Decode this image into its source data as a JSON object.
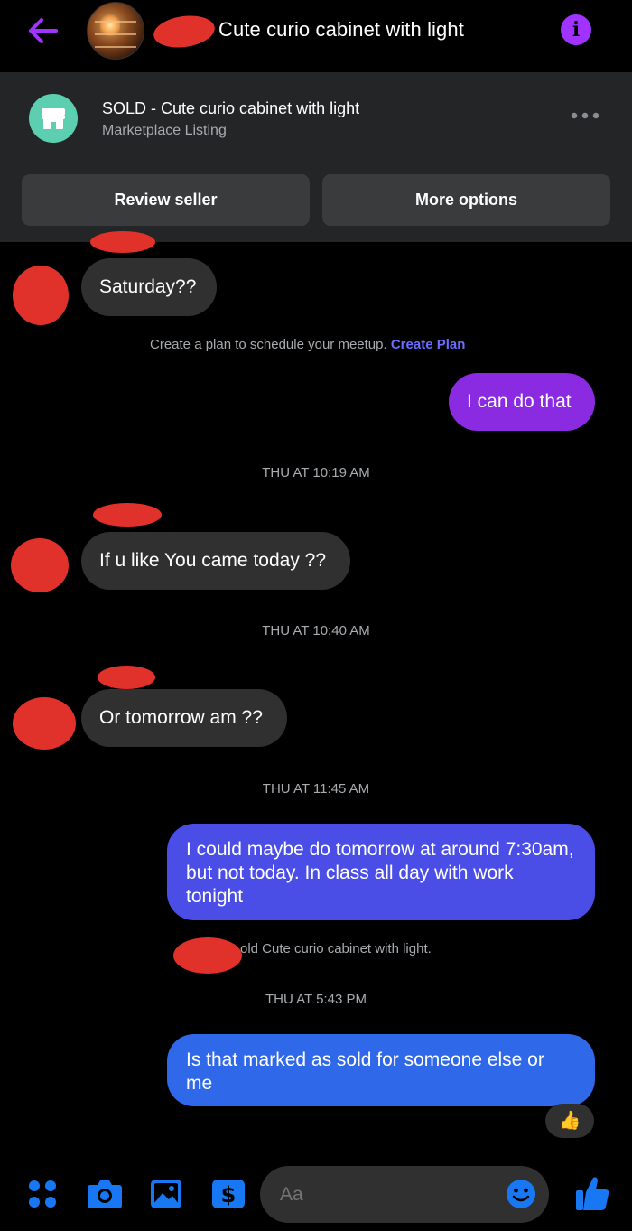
{
  "header": {
    "title": "Cute curio cabinet with light"
  },
  "listing": {
    "title": "SOLD - Cute curio cabinet with light",
    "subtitle": "Marketplace Listing",
    "review_button": "Review seller",
    "more_button": "More options"
  },
  "messages": [
    {
      "from": "other",
      "text": "Saturday??"
    },
    {
      "type": "system",
      "text": "Create a plan to schedule your meetup.",
      "link": "Create Plan"
    },
    {
      "from": "me",
      "text": "I can do that"
    },
    {
      "type": "timestamp",
      "text": "THU AT 10:19 AM"
    },
    {
      "from": "other",
      "text": "If u like You came today ??"
    },
    {
      "type": "timestamp",
      "text": "THU AT 10:40 AM"
    },
    {
      "from": "other",
      "text": "Or tomorrow am ??"
    },
    {
      "type": "timestamp",
      "text": "THU AT 11:45 AM"
    },
    {
      "from": "me",
      "text": "I could maybe do tomorrow at around 7:30am, but not today. In class all day with work tonight"
    },
    {
      "type": "system",
      "text": "old Cute curio cabinet with light."
    },
    {
      "type": "timestamp",
      "text": "THU AT 5:43 PM"
    },
    {
      "from": "me",
      "text": "Is that marked as sold for someone else or me",
      "reaction": "👍"
    }
  ],
  "composer": {
    "placeholder": "Aa"
  },
  "icons": {
    "back": "arrow-left-icon",
    "info": "info-icon",
    "store": "storefront-icon",
    "menu": "more-horizontal-icon",
    "apps": "four-dots-icon",
    "camera": "camera-icon",
    "gallery": "image-icon",
    "payment": "dollar-icon",
    "emoji": "emoji-icon",
    "like": "thumbs-up-icon"
  },
  "colors": {
    "accent": "#a033ff",
    "link": "#6a6dff",
    "icon_blue": "#1877f2",
    "bubble_in": "#303030",
    "bubble_purple": "#8a2be2",
    "bubble_indigo": "#4a4ee6",
    "bubble_blue": "#2f68e8",
    "store_badge": "#5ccfb1"
  }
}
